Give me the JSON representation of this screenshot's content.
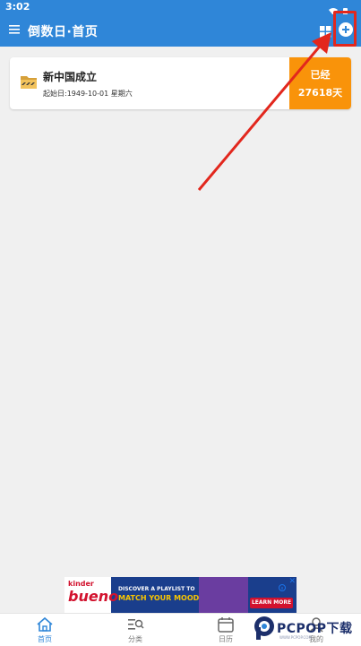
{
  "status_bar": {
    "time": "3:02"
  },
  "app_bar": {
    "title": "倒数日·首页"
  },
  "events": [
    {
      "name": "新中国成立",
      "start_label": "起始日:1949-10-01 星期六",
      "badge_line1": "已经",
      "badge_line2": "27618天"
    }
  ],
  "ad": {
    "brand_small": "kinder",
    "brand_big": "bueno",
    "line1": "DISCOVER A PLAYLIST TO",
    "line2": "MATCH YOUR MOOD",
    "cta": "LEARN MORE",
    "close": "✕"
  },
  "bottom_nav": {
    "home": "首页",
    "category": "分类",
    "calendar": "日历",
    "mine": "我的"
  },
  "watermark": {
    "text": "PCPOP下载",
    "small": "WWW.PCPOP.COM"
  },
  "colors": {
    "primary": "#2f86d8",
    "badge": "#f9930a",
    "highlight": "#e2271d"
  }
}
